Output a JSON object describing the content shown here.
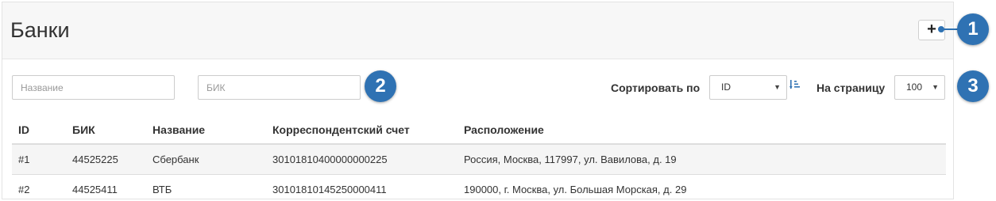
{
  "page": {
    "title": "Банки",
    "add_label": "+"
  },
  "filters": {
    "name_placeholder": "Название",
    "bik_placeholder": "БИК",
    "sort_label": "Сортировать по",
    "sort_value": "ID",
    "per_page_label": "На страницу",
    "per_page_value": "100"
  },
  "table": {
    "columns": [
      "ID",
      "БИК",
      "Название",
      "Корреспондентский счет",
      "Расположение"
    ],
    "rows": [
      [
        "#1",
        "44525225",
        "Сбербанк",
        "30101810400000000225",
        "Россия, Москва, 117997, ул. Вавилова, д. 19"
      ],
      [
        "#2",
        "44525411",
        "ВТБ",
        "30101810145250000411",
        "190000, г. Москва, ул. Большая Морская, д. 29"
      ]
    ]
  },
  "callouts": [
    "1",
    "2",
    "3"
  ],
  "colors": {
    "callout": "#2f72b3",
    "sort_icon": "#2f72b3"
  }
}
